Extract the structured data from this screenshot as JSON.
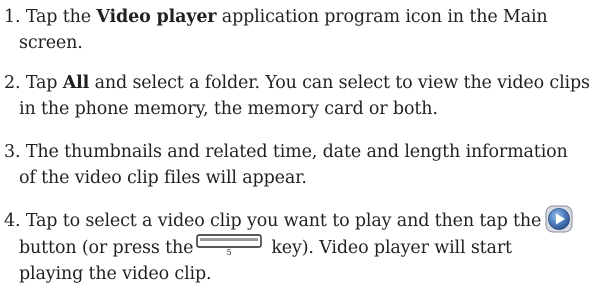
{
  "steps": [
    {
      "number": "1.",
      "line1_pre": "Tap the ",
      "bold": "Video player",
      "line1_post": " application program icon in the Main",
      "line2": "screen."
    },
    {
      "number": "2.",
      "line1_pre": "Tap ",
      "bold": "All",
      "line1_post": " and select a folder. You can select to view the video clips",
      "line2": "in the phone memory, the memory card or both."
    },
    {
      "number": "3.",
      "line1": "The thumbnails and related time, date and length information",
      "line2": "of the video clip files will appear."
    },
    {
      "number": "4.",
      "line1": "Tap to select a video clip you want to play and then tap the",
      "line2_pre": "button (or press the",
      "key_label": "5",
      "line2_post": "key). Video player will start",
      "line3": "playing the video clip."
    }
  ],
  "icons": {
    "play": "play-button-icon",
    "key": "key-5-icon"
  },
  "colors": {
    "text": "#231f20",
    "play_button_bg": "#4f7fbf"
  }
}
